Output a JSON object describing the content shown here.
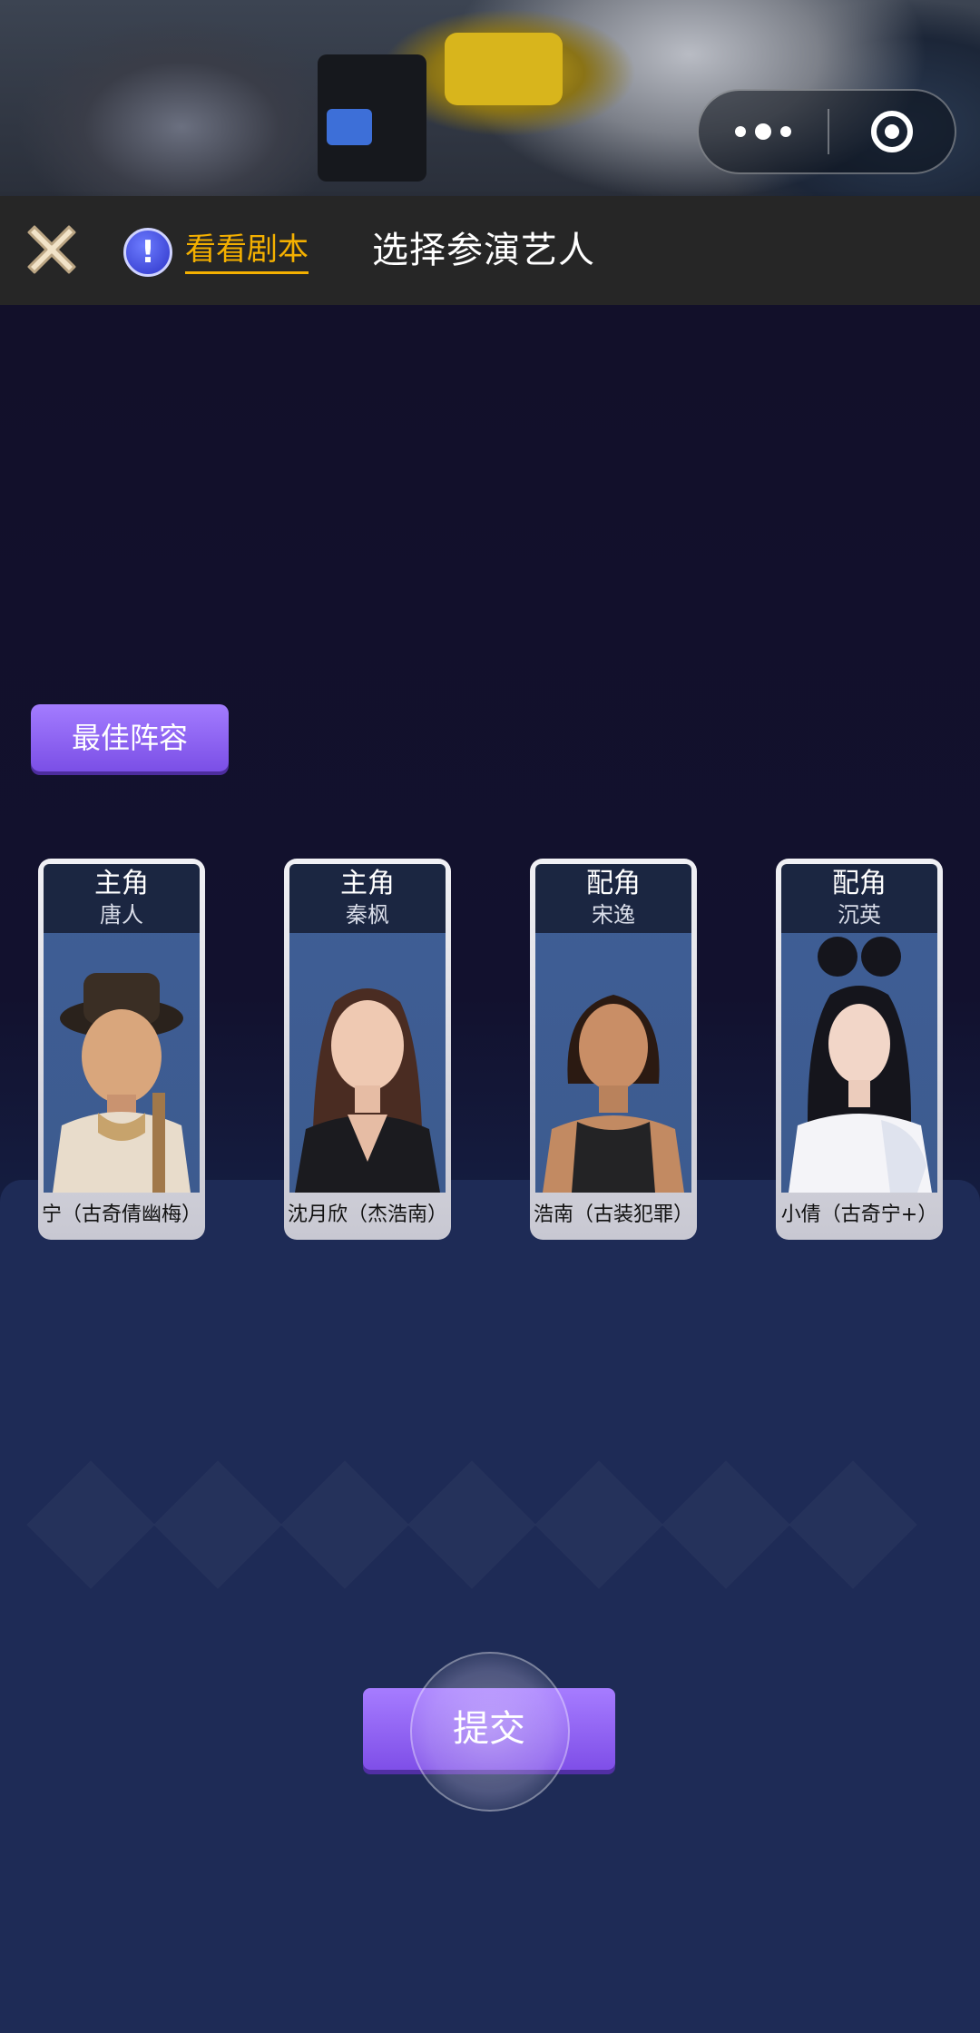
{
  "header": {
    "script_label": "看看剧本",
    "title": "选择参演艺人"
  },
  "lineup": {
    "best_button_label": "最佳阵容"
  },
  "cast": [
    {
      "role": "主角",
      "character": "唐人",
      "actor": "宁（古奇倩幽梅）"
    },
    {
      "role": "主角",
      "character": "秦枫",
      "actor": "沈月欣（杰浩南）"
    },
    {
      "role": "配角",
      "character": "宋逸",
      "actor": "浩南（古装犯罪）"
    },
    {
      "role": "配角",
      "character": "沉英",
      "actor": "小倩（古奇宁+）"
    }
  ],
  "submit_label": "提交",
  "icons": {
    "close": "close-icon",
    "script": "exclamation-icon",
    "more": "more-dots-icon",
    "exit": "target-circle-icon"
  },
  "colors": {
    "accent_gold": "#f4b000",
    "button_purple": "#8f63f2",
    "background": "#12102a",
    "panel": "#1e2b56"
  }
}
